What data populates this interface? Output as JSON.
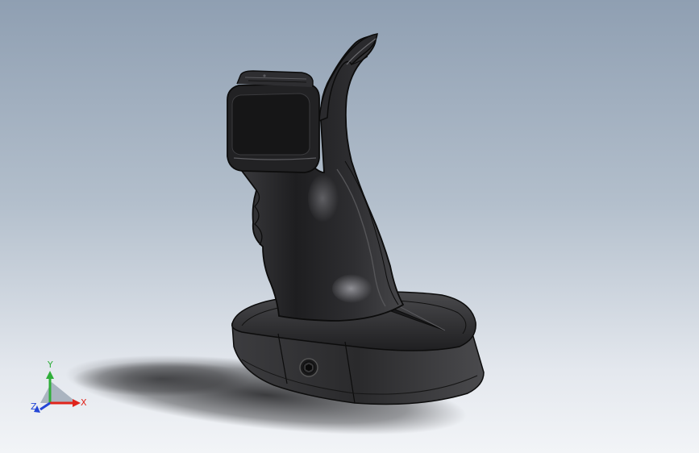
{
  "viewport": {
    "background_top": "#8f9fb2",
    "background_bottom": "#f2f4f7"
  },
  "model": {
    "body_color": "#2c2c2e",
    "highlight_color": "#6b6b6e",
    "edge_color": "#0c0c0c"
  },
  "triad": {
    "x_label": "X",
    "y_label": "Y",
    "z_label": "Z",
    "x_color": "#e0241b",
    "y_color": "#2fae3a",
    "z_color": "#2446d6"
  }
}
